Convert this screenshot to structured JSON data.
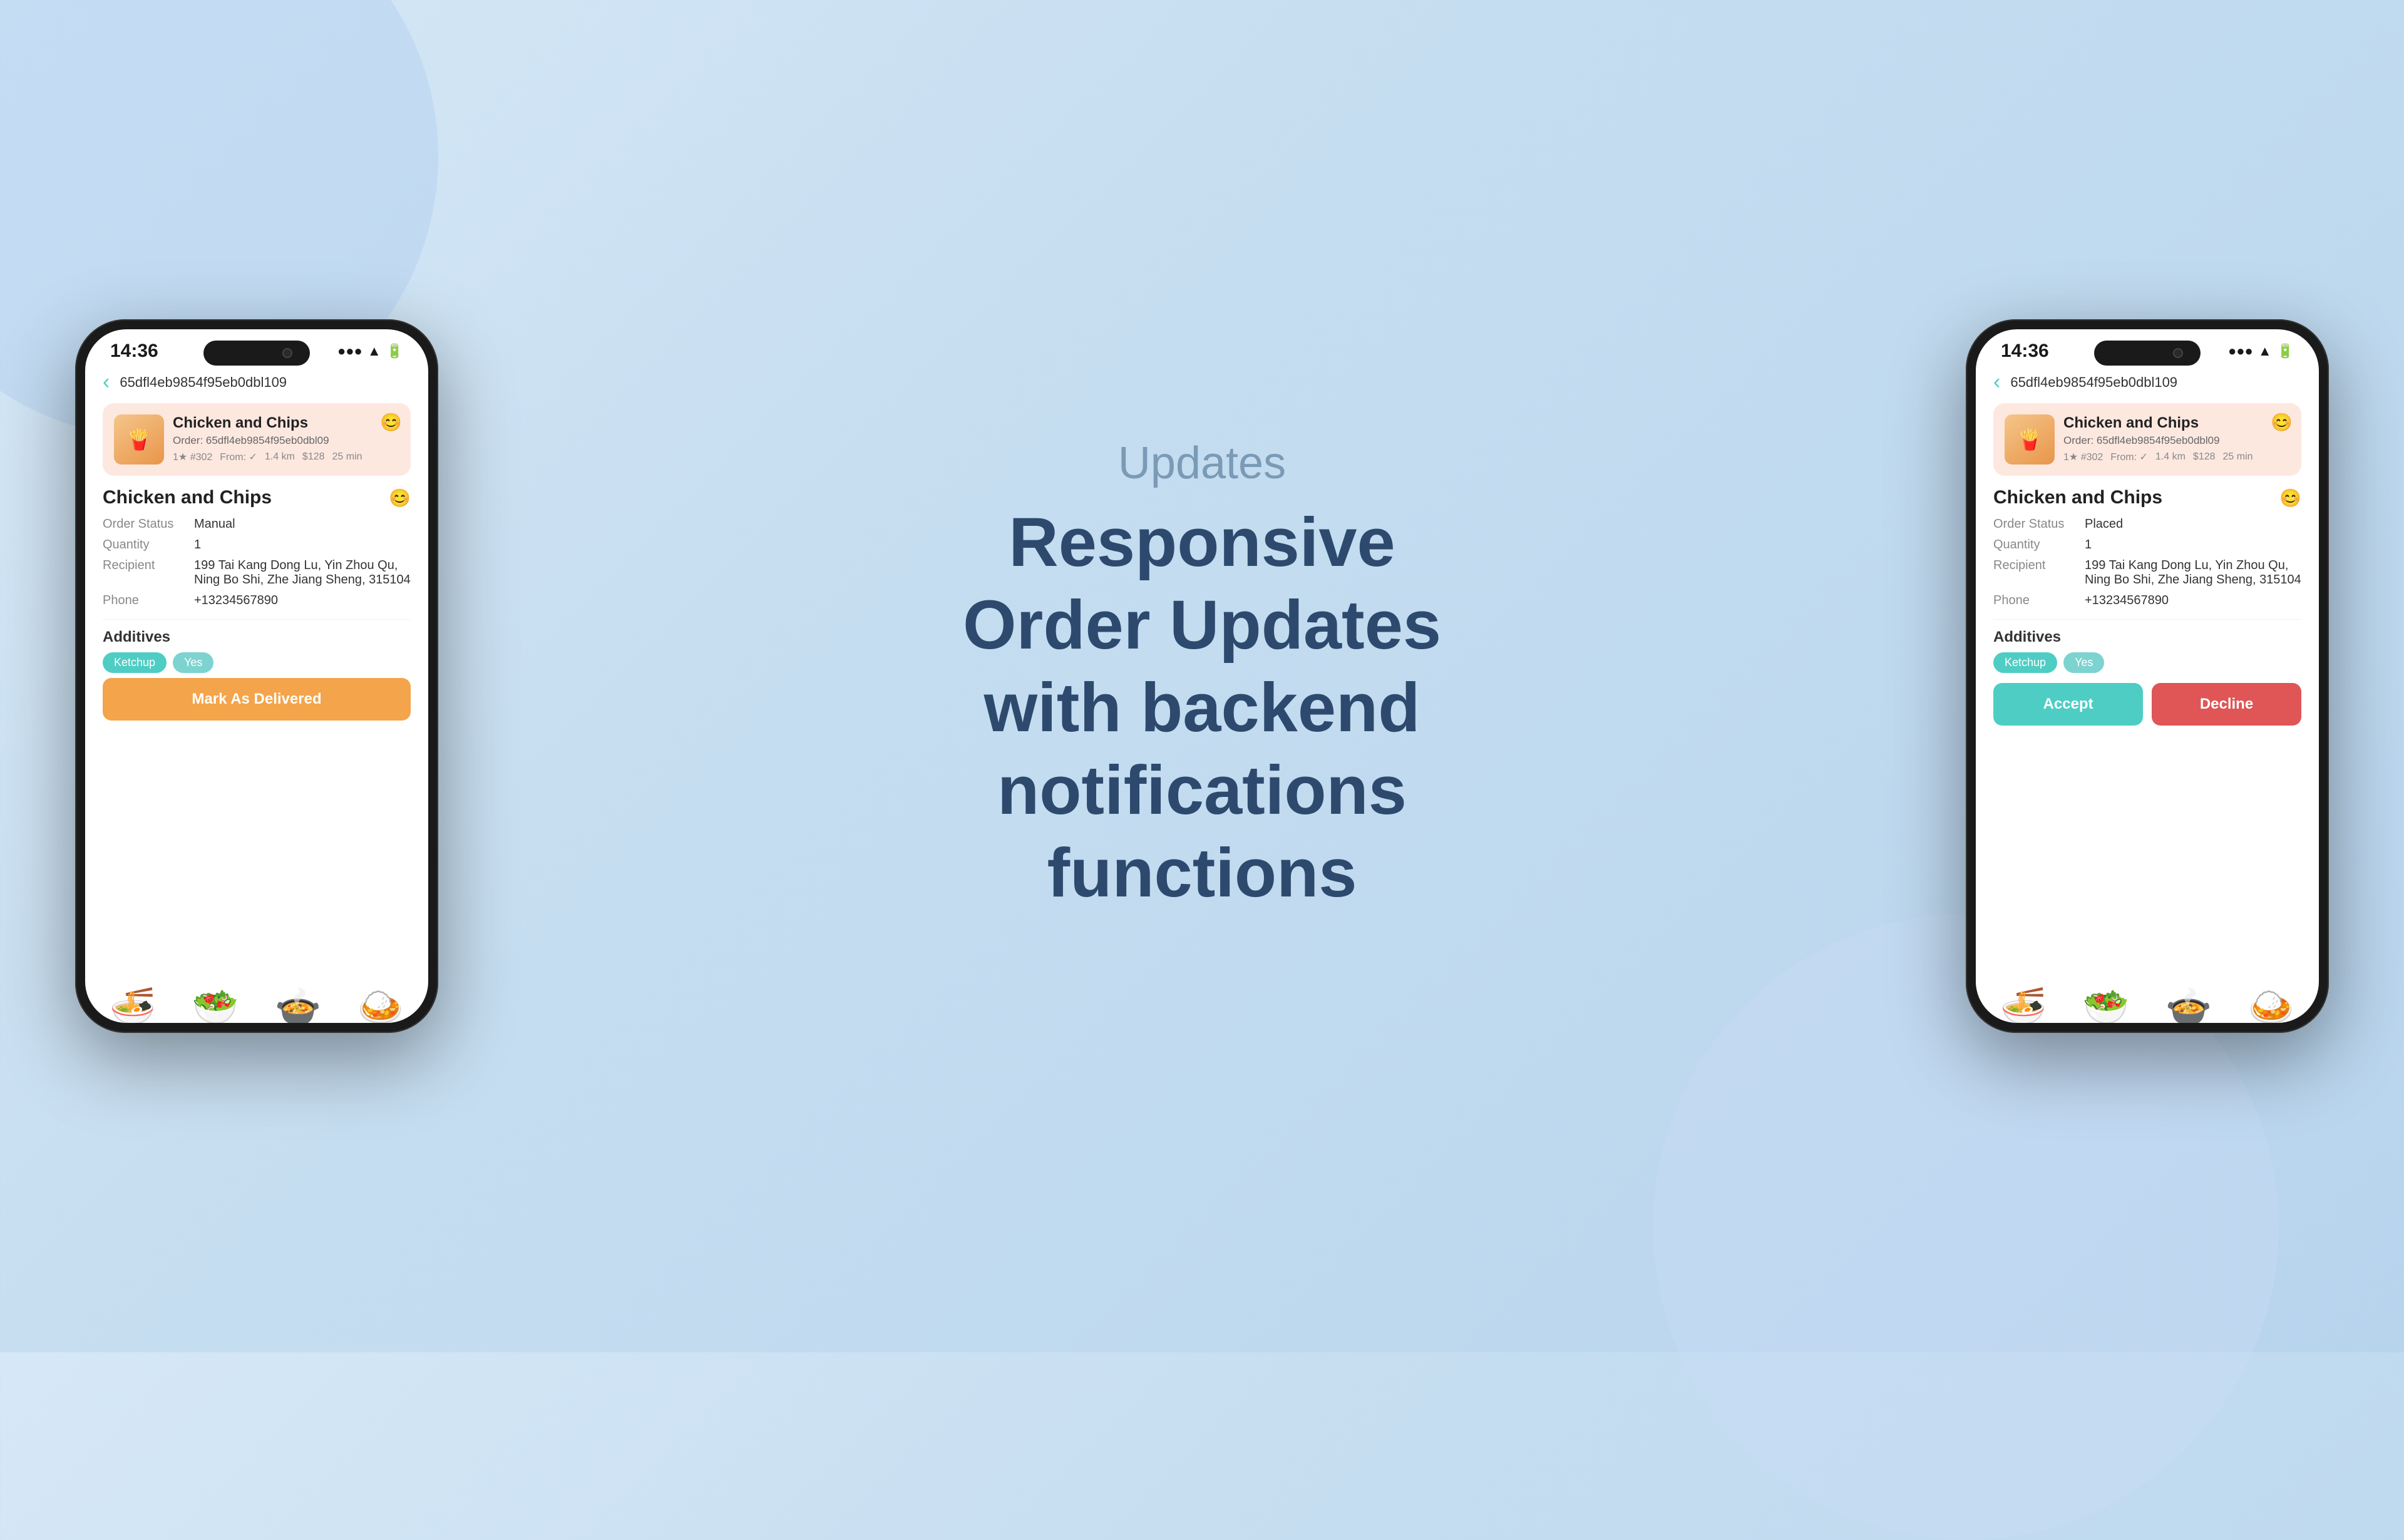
{
  "background": {
    "color_start": "#d6e8f7",
    "color_end": "#b8d4ed"
  },
  "center": {
    "updates_label": "Updates",
    "heading_line1": "Responsive",
    "heading_line2": "Order Updates",
    "heading_line3": "with backend",
    "heading_line4": "notifications",
    "heading_line5": "functions"
  },
  "phone_left": {
    "status_bar": {
      "time": "14:36",
      "icons": "▲ ▼ ⊙ ◻"
    },
    "header": {
      "back_label": "‹",
      "order_id": "65dfl4eb9854f95eb0dbl109"
    },
    "order_card": {
      "title": "Chicken and Chips",
      "subtitle": "Order: 65dfl4eb9854f95eb0dbl09",
      "meta_rating": "1★ #302",
      "meta_from": "From: ✓",
      "meta_distance": "1.4 km",
      "meta_price": "$128",
      "meta_time": "25 min",
      "emoji": "😊"
    },
    "detail": {
      "title": "Chicken and Chips",
      "order_status_label": "Order Status",
      "order_status_value": "Manual",
      "quantity_label": "Quantity",
      "quantity_value": "1",
      "recipient_label": "Recipient",
      "recipient_value": "199 Tai Kang Dong Lu, Yin Zhou Qu, Ning Bo Shi, Zhe Jiang Sheng, 315104",
      "phone_label": "Phone",
      "phone_value": "+13234567890"
    },
    "additives": {
      "label": "Additives",
      "tag1": "Ketchup",
      "tag2": "Yes"
    },
    "action": {
      "button_label": "Mark As Delivered"
    }
  },
  "phone_right": {
    "status_bar": {
      "time": "14:36",
      "icons": "▲ ▼ ⊙ ◻"
    },
    "header": {
      "back_label": "‹",
      "order_id": "65dfl4eb9854f95eb0dbl109"
    },
    "order_card": {
      "title": "Chicken and Chips",
      "subtitle": "Order: 65dfl4eb9854f95eb0dbl09",
      "meta_rating": "1★ #302",
      "meta_from": "From: ✓",
      "meta_distance": "1.4 km",
      "meta_price": "$128",
      "meta_time": "25 min",
      "emoji": "😊"
    },
    "detail": {
      "title": "Chicken and Chips",
      "order_status_label": "Order Status",
      "order_status_value": "Placed",
      "quantity_label": "Quantity",
      "quantity_value": "1",
      "recipient_label": "Recipient",
      "recipient_value": "199 Tai Kang Dong Lu, Yin Zhou Qu, Ning Bo Shi, Zhe Jiang Sheng, 315104",
      "phone_label": "Phone",
      "phone_value": "+13234567890"
    },
    "additives": {
      "label": "Additives",
      "tag1": "Ketchup",
      "tag2": "Yes"
    },
    "actions": {
      "accept_label": "Accept",
      "decline_label": "Decline"
    }
  }
}
